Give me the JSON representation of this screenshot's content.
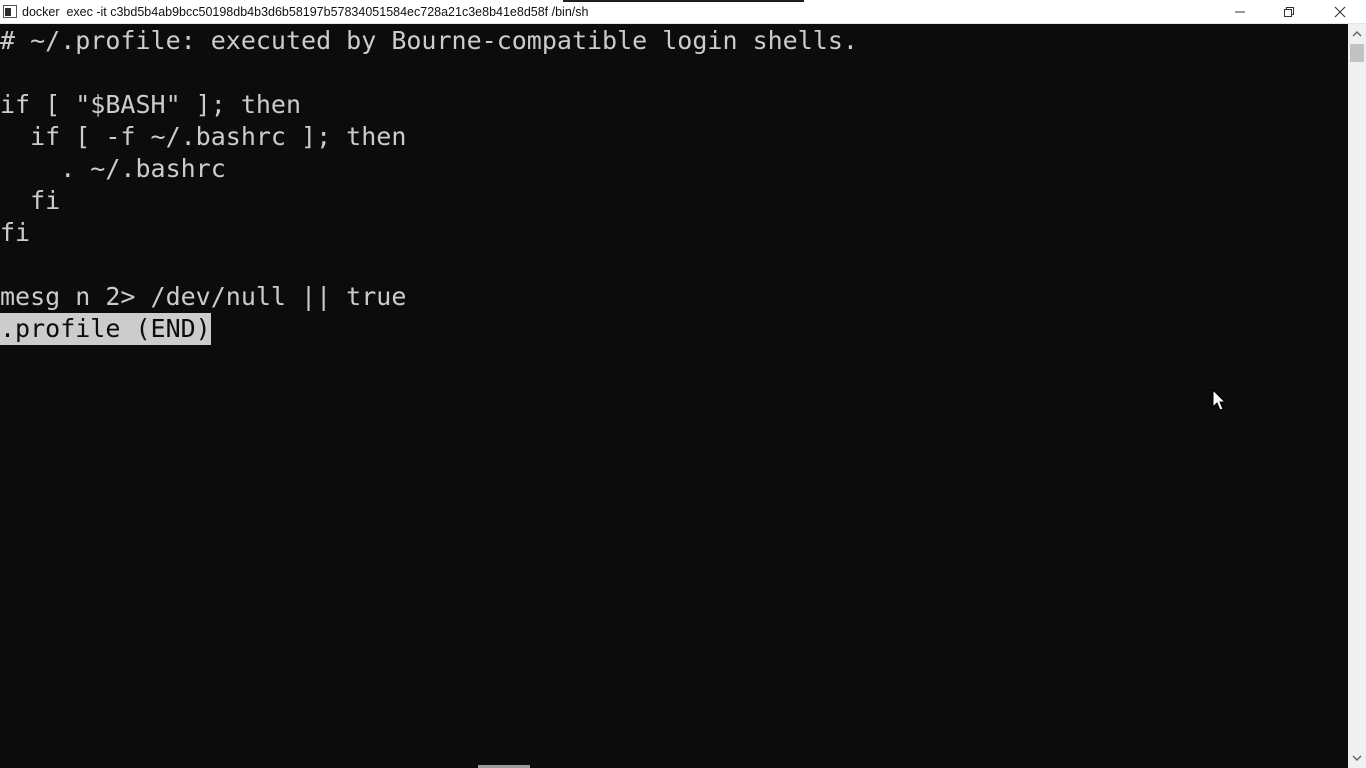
{
  "window": {
    "title": "docker  exec -it c3bd5b4ab9bcc50198db4b3d6b58197b57834051584ec728a21c3e8b41e8d58f /bin/sh",
    "icon": "console-icon",
    "controls": [
      "minimize-icon",
      "restore-icon",
      "close-icon"
    ]
  },
  "colors": {
    "background": "#0c0c0c",
    "foreground": "#cccccc",
    "titlebar": "#ffffff"
  },
  "terminal": {
    "lines": [
      "# ~/.profile: executed by Bourne-compatible login shells.",
      "",
      "if [ \"$BASH\" ]; then",
      "  if [ -f ~/.bashrc ]; then",
      "    . ~/.bashrc",
      "  fi",
      "fi",
      "",
      "mesg n 2> /dev/null || true"
    ],
    "status_line": ".profile (END)"
  }
}
